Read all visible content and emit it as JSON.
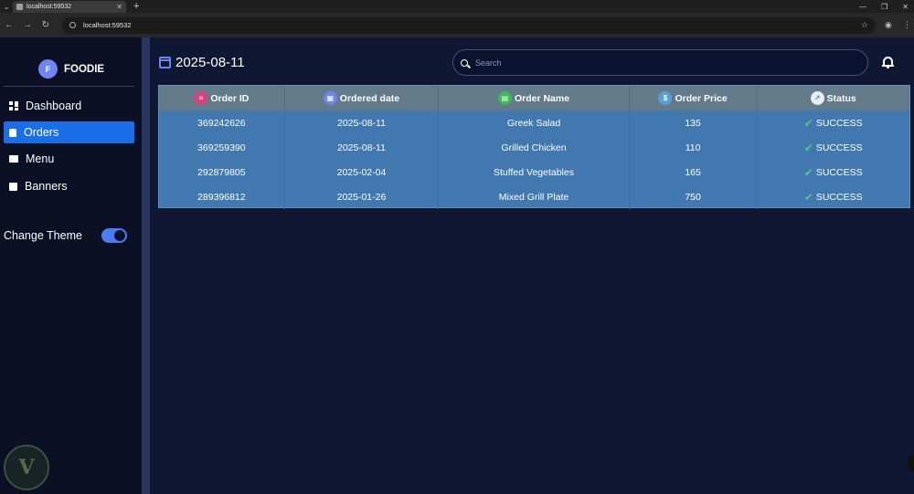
{
  "browser": {
    "tab_title": "localhost:59532",
    "url": "localhost:59532"
  },
  "sidebar": {
    "brand_letter": "F",
    "brand_name": "FOODIE",
    "items": [
      {
        "label": "Dashboard",
        "icon": "dashboard-icon"
      },
      {
        "label": "Orders",
        "icon": "bag-icon",
        "active": true
      },
      {
        "label": "Menu",
        "icon": "menu-book-icon"
      },
      {
        "label": "Banners",
        "icon": "image-icon"
      }
    ],
    "theme_label": "Change Theme",
    "theme_enabled": true
  },
  "header": {
    "date": "2025-08-11",
    "search_placeholder": "Search"
  },
  "table": {
    "columns": [
      {
        "label": "Order ID",
        "icon": "list-icon",
        "color": "#d6417e"
      },
      {
        "label": "Ordered date",
        "icon": "calendar-icon",
        "color": "#6f86f0"
      },
      {
        "label": "Order Name",
        "icon": "food-icon",
        "color": "#3cba54"
      },
      {
        "label": "Order Price",
        "icon": "dollar-icon",
        "color": "#5aa0d8"
      },
      {
        "label": "Status",
        "icon": "trend-icon",
        "color": "#e8eef2"
      }
    ],
    "rows": [
      {
        "id": "369242626",
        "date": "2025-08-11",
        "name": "Greek Salad",
        "price": "135",
        "status": "SUCCESS"
      },
      {
        "id": "369259390",
        "date": "2025-08-11",
        "name": "Grilled Chicken",
        "price": "110",
        "status": "SUCCESS"
      },
      {
        "id": "292879805",
        "date": "2025-02-04",
        "name": "Stuffed Vegetables",
        "price": "165",
        "status": "SUCCESS"
      },
      {
        "id": "289396812",
        "date": "2025-01-26",
        "name": "Mixed Grill Plate",
        "price": "750",
        "status": "SUCCESS"
      }
    ]
  },
  "colors": {
    "accent": "#1a6fe8",
    "table_body": "#4178b0",
    "table_header": "#637a8a",
    "success": "#4ec98a"
  }
}
